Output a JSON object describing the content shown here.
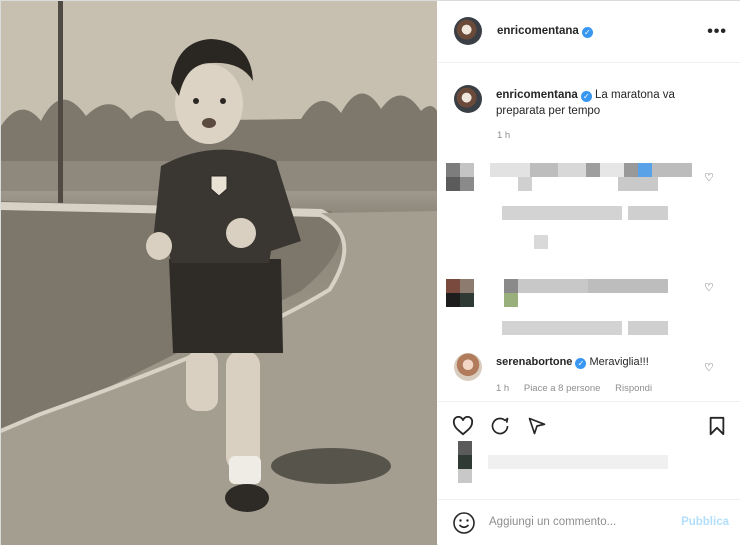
{
  "post": {
    "author": "enricomentana",
    "caption_text": "La maratona va preparata per tempo",
    "caption_time": "1 h",
    "more_label": "•••"
  },
  "comments": [
    {
      "user": "serenabortone",
      "text": "Meraviglia!!!",
      "time": "1 h",
      "likes": "Piace a 8 persone",
      "reply": "Rispondi"
    }
  ],
  "add_comment": {
    "placeholder": "Aggiungi un commento...",
    "publish": "Pubblica"
  },
  "icons": {
    "verified": "✓",
    "heart": "♡"
  },
  "colors": {
    "verified_blue": "#3897f0",
    "publish_disabled": "#b2dffc",
    "muted_text": "#8e8e8e"
  }
}
